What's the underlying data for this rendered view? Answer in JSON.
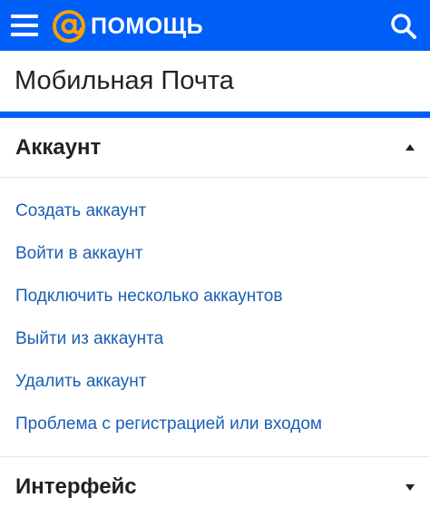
{
  "header": {
    "logo_text": "ПОМОЩЬ",
    "background_color": "#005ff9",
    "menu_icon": "hamburger-menu-icon",
    "logo_icon": "mail-at-logo-icon",
    "search_icon": "search-icon"
  },
  "page": {
    "title": "Мобильная Почта"
  },
  "sections": [
    {
      "title": "Аккаунт",
      "expanded": true,
      "links": [
        "Создать аккаунт",
        "Войти в аккаунт",
        "Подключить несколько аккаунтов",
        "Выйти из аккаунта",
        "Удалить аккаунт",
        "Проблема с регистрацией или входом"
      ]
    },
    {
      "title": "Интерфейс",
      "expanded": false
    }
  ],
  "colors": {
    "accent": "#005ff9",
    "link": "#1a5fb4",
    "logo_orange": "#ff9e00"
  }
}
